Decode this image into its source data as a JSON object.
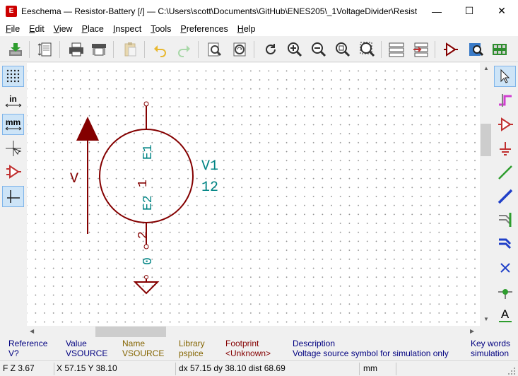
{
  "window": {
    "title": "Eeschema — Resistor-Battery [/] — C:\\Users\\scott\\Documents\\GitHub\\ENES205\\_1VoltageDivider\\Resist...",
    "app_icon": "eeschema-icon",
    "minimize": "—",
    "maximize": "☐",
    "close": "✕"
  },
  "menu": [
    {
      "u": "F",
      "rest": "ile"
    },
    {
      "u": "E",
      "rest": "dit"
    },
    {
      "u": "V",
      "rest": "iew"
    },
    {
      "u": "P",
      "rest": "lace"
    },
    {
      "u": "I",
      "rest": "nspect"
    },
    {
      "u": "T",
      "rest": "ools"
    },
    {
      "u": "P",
      "rest": "references"
    },
    {
      "u": "H",
      "rest": "elp"
    }
  ],
  "toolbar_icons": [
    "save-icon",
    "page-settings-icon",
    "print-icon",
    "plot-icon",
    "paste-icon",
    "undo-icon",
    "redo-icon",
    "find-icon",
    "find-replace-icon",
    "refresh-icon",
    "zoom-in-icon",
    "zoom-out-icon",
    "zoom-fit-icon",
    "zoom-selection-icon",
    "hierarchy-navigator-icon",
    "leave-sheet-icon",
    "symbol-editor-icon",
    "symbol-browser-icon",
    "footprint-assign-icon"
  ],
  "left_toolbar": {
    "grid": "grid-icon",
    "units_in": "in",
    "units_mm": "mm",
    "cursor": "full-cursor-icon",
    "hidden_pins": "hidden-pins-icon",
    "line_mode": "line-mode-icon"
  },
  "right_toolbar": {
    "A": "A",
    "icons": [
      "select-arrow-icon",
      "highlight-net-icon",
      "add-symbol-icon",
      "add-power-icon",
      "add-wire-icon",
      "add-bus-icon",
      "wire-bus-entry-icon",
      "bus-bus-entry-icon",
      "no-connect-icon",
      "add-junction-icon",
      "add-label-icon"
    ]
  },
  "schematic": {
    "arrow_label": "V",
    "ref": "V1",
    "value": "12",
    "pin1_number": "1",
    "pin2_number": "2",
    "pin1_name": "E1",
    "pin2_name": "E2",
    "ground_net": "0",
    "colors": {
      "body": "#840000",
      "text_teal": "#008484",
      "canvas": "#ffffff"
    }
  },
  "info": {
    "reference": {
      "label": "Reference",
      "value": "V?"
    },
    "value": {
      "label": "Value",
      "value": "VSOURCE"
    },
    "name": {
      "label": "Name",
      "value": "VSOURCE"
    },
    "library": {
      "label": "Library",
      "value": "pspice"
    },
    "footprint": {
      "label": "Footprint",
      "value": "<Unknown>"
    },
    "description": {
      "label": "Description",
      "value": "Voltage source symbol for simulation only"
    },
    "keywords": {
      "label": "Key words",
      "value": "simulation"
    }
  },
  "status": {
    "zoom": "F  Z 3.67",
    "xy": "X 57.15  Y 38.10",
    "delta": "dx 57.15  dy 38.10  dist 68.69",
    "units": "mm"
  }
}
